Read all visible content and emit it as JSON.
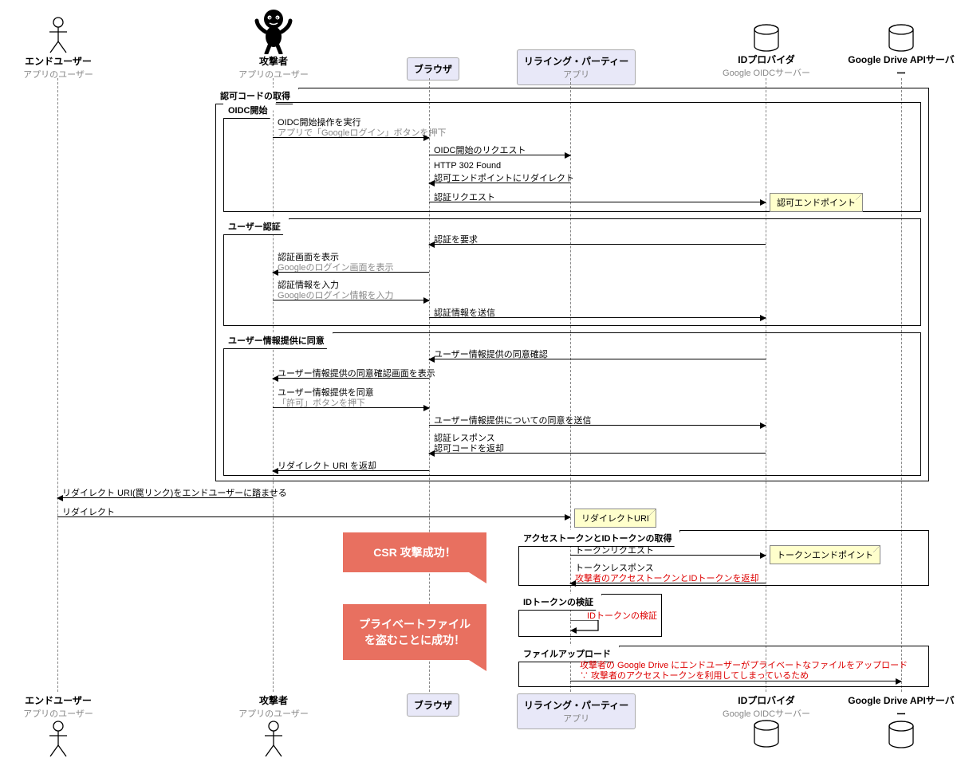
{
  "participants": {
    "enduser": {
      "label": "エンドユーザー",
      "sub": "アプリのユーザー"
    },
    "attacker": {
      "label": "攻撃者",
      "sub": "アプリのユーザー"
    },
    "browser": {
      "label": "ブラウザ"
    },
    "rp": {
      "label": "リライング・パーティー",
      "sub": "アプリ"
    },
    "idp": {
      "label": "IDプロバイダ",
      "sub": "Google OIDCサーバー"
    },
    "drive": {
      "label": "Google Drive APIサーバー"
    }
  },
  "frames": {
    "auth_code": "認可コードの取得",
    "oidc_start": "OIDC開始",
    "user_auth": "ユーザー認証",
    "consent": "ユーザー情報提供に同意",
    "tokens": "アクセストークンとIDトークンの取得",
    "verify": "IDトークンの検証",
    "upload": "ファイルアップロード"
  },
  "messages": {
    "m1": "OIDC開始操作を実行",
    "m1s": "アプリで「Googleログイン」ボタンを押下",
    "m2": "OIDC開始のリクエスト",
    "m3a": "HTTP 302 Found",
    "m3b": "認可エンドポイントにリダイレクト",
    "m4": "認証リクエスト",
    "m5": "認証を要求",
    "m6a": "認証画面を表示",
    "m6b": "Googleのログイン画面を表示",
    "m7a": "認証情報を入力",
    "m7b": "Googleのログイン情報を入力",
    "m8": "認証情報を送信",
    "m9": "ユーザー情報提供の同意確認",
    "m10": "ユーザー情報提供の同意確認画面を表示",
    "m11a": "ユーザー情報提供を同意",
    "m11b": "「許可」ボタンを押下",
    "m12": "ユーザー情報提供についての同意を送信",
    "m13a": "認証レスポンス",
    "m13b": "認可コードを返却",
    "m14": "リダイレクト URI を返却",
    "m15": "リダイレクト URI(罠リンク)をエンドユーザーに踏ませる",
    "m16": "リダイレクト",
    "m17": "トークンリクエスト",
    "m18a": "トークンレスポンス",
    "m18b": "攻撃者のアクセストークンとIDトークンを返却",
    "m19": "IDトークンの検証",
    "m20a": "攻撃者の Google Drive にエンドユーザーがプライベートなファイルをアップロード",
    "m20b": "∵ 攻撃者のアクセストークンを利用してしまっているため"
  },
  "notes": {
    "n1": "認可エンドポイント",
    "n2": "リダイレクトURI",
    "n3": "トークンエンドポイント"
  },
  "callouts": {
    "c1": "CSR 攻撃成功！",
    "c2": "プライベートファイルを盗むことに成功！"
  }
}
